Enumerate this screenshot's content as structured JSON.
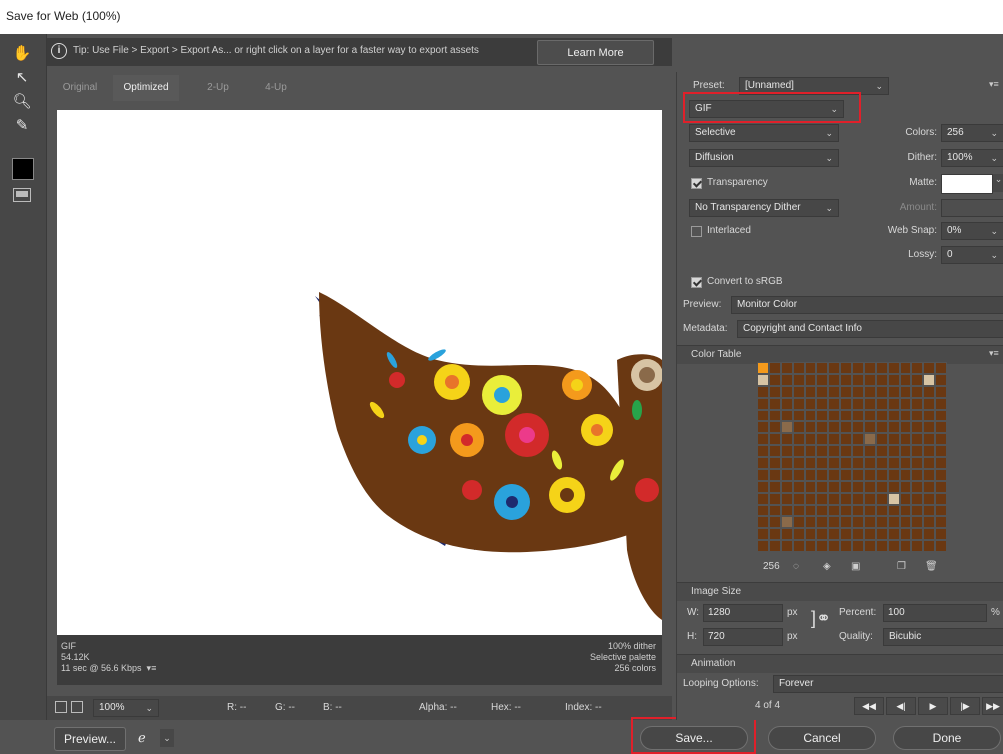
{
  "window": {
    "title": "Save for Web (100%)"
  },
  "tip": {
    "text": "Tip: Use File > Export > Export As... or right click on a layer for a faster way to export assets",
    "learn_more": "Learn More"
  },
  "tabs": [
    {
      "label": "Original"
    },
    {
      "label": "Optimized"
    },
    {
      "label": "2-Up"
    },
    {
      "label": "4-Up"
    }
  ],
  "image_info": {
    "format": "GIF",
    "size": "54.12K",
    "time": "11 sec @ 56.6 Kbps",
    "dither": "100% dither",
    "palette": "Selective palette",
    "colors": "256 colors"
  },
  "status": {
    "zoom": "100%",
    "r": "R: --",
    "g": "G: --",
    "b": "B: --",
    "alpha": "Alpha: --",
    "hex": "Hex: --",
    "index": "Index: --"
  },
  "buttons": {
    "preview": "Preview...",
    "save": "Save...",
    "cancel": "Cancel",
    "done": "Done"
  },
  "settings": {
    "preset_label": "Preset:",
    "preset_value": "[Unnamed]",
    "format": "GIF",
    "reduction": "Selective",
    "dither_algo": "Diffusion",
    "transparency_label": "Transparency",
    "transparency_dither": "No Transparency Dither",
    "interlaced_label": "Interlaced",
    "colors_label": "Colors:",
    "colors_value": "256",
    "dither_label": "Dither:",
    "dither_value": "100%",
    "matte_label": "Matte:",
    "amount_label": "Amount:",
    "websnap_label": "Web Snap:",
    "websnap_value": "0%",
    "lossy_label": "Lossy:",
    "lossy_value": "0",
    "convert_label": "Convert to sRGB",
    "preview_label": "Preview:",
    "preview_value": "Monitor Color",
    "metadata_label": "Metadata:",
    "metadata_value": "Copyright and Contact Info"
  },
  "color_table": {
    "title": "Color Table",
    "count": "256"
  },
  "image_size": {
    "title": "Image Size",
    "w_label": "W:",
    "w_value": "1280",
    "w_unit": "px",
    "h_label": "H:",
    "h_value": "720",
    "h_unit": "px",
    "percent_label": "Percent:",
    "percent_value": "100",
    "percent_unit": "%",
    "quality_label": "Quality:",
    "quality_value": "Bicubic"
  },
  "animation": {
    "title": "Animation",
    "looping_label": "Looping Options:",
    "looping_value": "Forever",
    "frame": "4 of 4"
  },
  "colors": {
    "highlight": "#e0202a",
    "panel": "#535353",
    "dark": "#474747"
  }
}
